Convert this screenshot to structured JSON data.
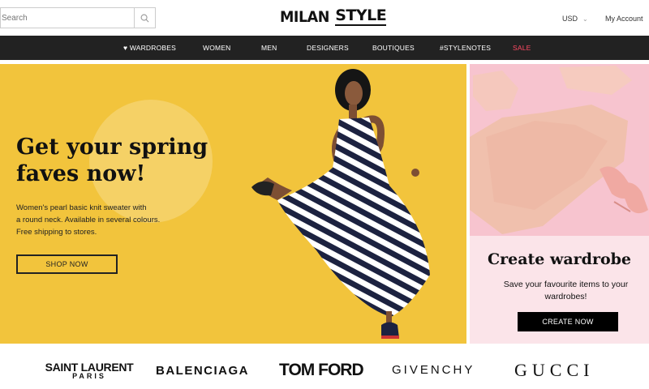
{
  "header": {
    "search_placeholder": "Search",
    "logo_part1": "MILAN",
    "logo_part2": "STYLE",
    "currency": "USD",
    "account": "My Account"
  },
  "nav": {
    "items": [
      "WARDROBES",
      "WOMEN",
      "MEN",
      "DESIGNERS",
      "BOUTIQUES",
      "#STYLENOTES",
      "SALE"
    ],
    "sale_color": "#ff4a63"
  },
  "hero": {
    "title": "Get your spring faves now!",
    "description_lines": [
      "Women's pearl basic knit sweater with",
      "a round neck. Available in several colours.",
      "Free shipping to stores."
    ],
    "button": "SHOP NOW",
    "bg_color": "#f2c43c"
  },
  "side_promo": {
    "title": "Create wardrobe",
    "description": "Save your favourite items to your wardrobes!",
    "button": "CREATE NOW",
    "bg_color": "#f7c4cf"
  },
  "brands": {
    "saint_laurent": "SAINT LAURENT",
    "saint_laurent_sub": "PARIS",
    "balenciaga": "BALENCIAGA",
    "tom_ford": "TOM FORD",
    "givenchy": "GIVENCHY",
    "gucci": "GUCCI"
  }
}
